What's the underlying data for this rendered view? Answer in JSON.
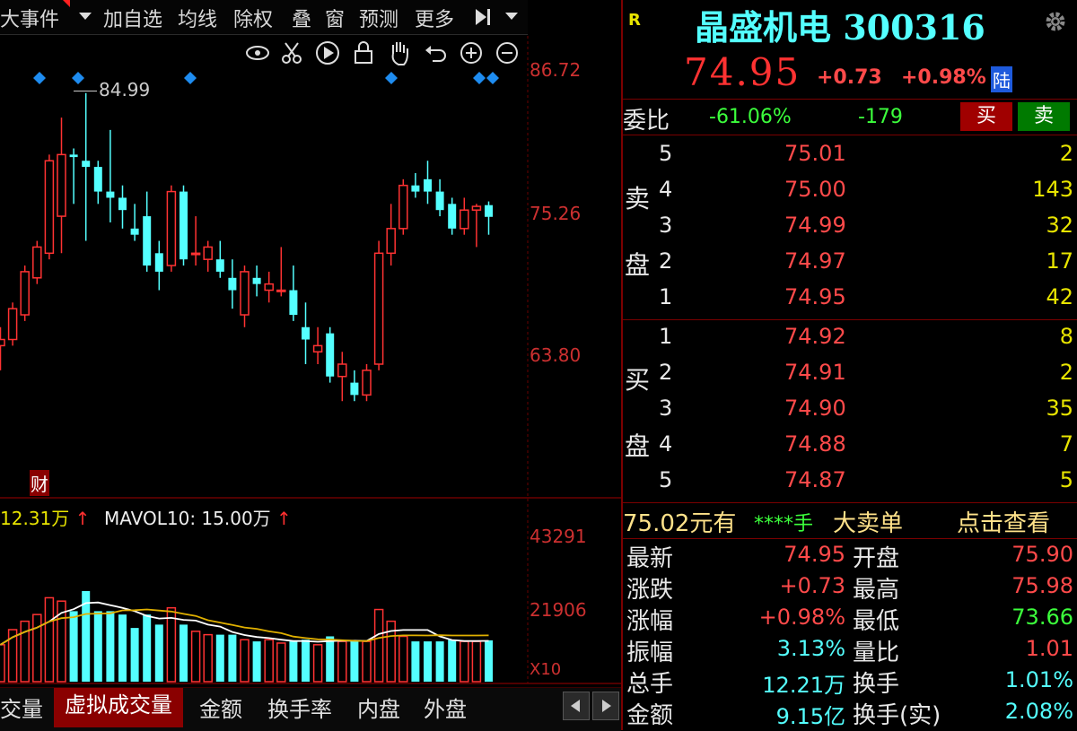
{
  "toolbar": {
    "items": [
      "大事件",
      "加自选",
      "均线",
      "除权",
      "叠",
      "窗",
      "预测",
      "更多"
    ]
  },
  "chart": {
    "high_label": "84.99",
    "price_axis": [
      "86.72",
      "75.26",
      "63.80"
    ],
    "fin_marker": "财",
    "vol_indicator": "12.31万",
    "mavol_label": "MAVOL10: 15.00万",
    "vol_axis": [
      "43291",
      "21906",
      "X10"
    ]
  },
  "chart_data": {
    "type": "candlestick",
    "candles": [
      {
        "o": 64.5,
        "h": 66.0,
        "l": 62.5,
        "c": 65.0
      },
      {
        "o": 65.0,
        "h": 68.0,
        "l": 64.5,
        "c": 67.5
      },
      {
        "o": 67.0,
        "h": 71.0,
        "l": 66.5,
        "c": 70.5
      },
      {
        "o": 70.0,
        "h": 73.0,
        "l": 69.5,
        "c": 72.5
      },
      {
        "o": 72.0,
        "h": 80.0,
        "l": 71.5,
        "c": 79.5
      },
      {
        "o": 75.0,
        "h": 83.0,
        "l": 72.0,
        "c": 80.0
      },
      {
        "o": 80.0,
        "h": 80.5,
        "l": 76.0,
        "c": 79.8
      },
      {
        "o": 79.5,
        "h": 84.99,
        "l": 73.0,
        "c": 79.0
      },
      {
        "o": 79.0,
        "h": 79.5,
        "l": 76.0,
        "c": 77.0
      },
      {
        "o": 77.0,
        "h": 82.0,
        "l": 74.5,
        "c": 76.5
      },
      {
        "o": 76.5,
        "h": 77.5,
        "l": 74.0,
        "c": 75.5
      },
      {
        "o": 74.0,
        "h": 76.0,
        "l": 73.0,
        "c": 73.5
      },
      {
        "o": 75.0,
        "h": 77.0,
        "l": 70.5,
        "c": 71.0
      },
      {
        "o": 72.0,
        "h": 73.0,
        "l": 69.0,
        "c": 70.5
      },
      {
        "o": 71.0,
        "h": 77.5,
        "l": 70.5,
        "c": 77.0
      },
      {
        "o": 77.0,
        "h": 77.5,
        "l": 71.0,
        "c": 71.5
      },
      {
        "o": 72.0,
        "h": 75.0,
        "l": 71.0,
        "c": 72.0
      },
      {
        "o": 71.5,
        "h": 73.0,
        "l": 70.5,
        "c": 72.5
      },
      {
        "o": 71.5,
        "h": 73.0,
        "l": 70.0,
        "c": 70.5
      },
      {
        "o": 70.0,
        "h": 71.5,
        "l": 67.5,
        "c": 69.0
      },
      {
        "o": 67.0,
        "h": 71.0,
        "l": 66.0,
        "c": 70.5
      },
      {
        "o": 70.0,
        "h": 71.0,
        "l": 68.5,
        "c": 69.5
      },
      {
        "o": 69.0,
        "h": 70.5,
        "l": 68.0,
        "c": 69.5
      },
      {
        "o": 69.0,
        "h": 72.5,
        "l": 68.5,
        "c": 69.0
      },
      {
        "o": 69.0,
        "h": 71.0,
        "l": 66.5,
        "c": 67.0
      },
      {
        "o": 66.0,
        "h": 68.0,
        "l": 63.0,
        "c": 65.0
      },
      {
        "o": 64.0,
        "h": 66.0,
        "l": 63.0,
        "c": 64.5
      },
      {
        "o": 65.5,
        "h": 66.0,
        "l": 61.5,
        "c": 62.0
      },
      {
        "o": 62.0,
        "h": 64.0,
        "l": 60.0,
        "c": 63.0
      },
      {
        "o": 61.5,
        "h": 62.5,
        "l": 60.0,
        "c": 60.5
      },
      {
        "o": 60.5,
        "h": 63.0,
        "l": 60.0,
        "c": 62.5
      },
      {
        "o": 63.0,
        "h": 73.0,
        "l": 62.5,
        "c": 72.0
      },
      {
        "o": 72.0,
        "h": 76.0,
        "l": 71.0,
        "c": 74.0
      },
      {
        "o": 74.0,
        "h": 78.0,
        "l": 73.5,
        "c": 77.5
      },
      {
        "o": 77.5,
        "h": 78.5,
        "l": 76.5,
        "c": 77.0
      },
      {
        "o": 78.0,
        "h": 79.5,
        "l": 76.0,
        "c": 77.0
      },
      {
        "o": 77.0,
        "h": 78.0,
        "l": 75.0,
        "c": 75.5
      },
      {
        "o": 76.0,
        "h": 76.5,
        "l": 73.5,
        "c": 74.0
      },
      {
        "o": 74.0,
        "h": 76.5,
        "l": 73.5,
        "c": 75.5
      },
      {
        "o": 75.5,
        "h": 76.0,
        "l": 72.5,
        "c": 75.8
      },
      {
        "o": 75.9,
        "h": 76.2,
        "l": 73.5,
        "c": 74.95
      }
    ],
    "volumes": [
      11000,
      15500,
      18000,
      20000,
      25000,
      24000,
      21000,
      27000,
      21000,
      21000,
      20000,
      16000,
      20000,
      17000,
      22000,
      17000,
      15000,
      14000,
      14000,
      14000,
      12500,
      12000,
      12500,
      11500,
      12000,
      12500,
      11000,
      13500,
      12000,
      12000,
      12000,
      21500,
      18000,
      13500,
      12000,
      12000,
      12000,
      12500,
      12000,
      12000,
      12310
    ],
    "up_color": "#ff3232",
    "down_color": "#54ffff"
  },
  "quote": {
    "r_tag": "R",
    "name": "晶盛机电 300316",
    "price": "74.95",
    "change": "+0.73",
    "change_pct": "+0.98%",
    "tag": "陆",
    "weibi_label": "委比",
    "weibi_pct": "-61.06%",
    "weicha": "-179",
    "buy_btn": "买",
    "sell_btn": "卖"
  },
  "orderbook": {
    "sell_label_1": "卖",
    "sell_label_2": "盘",
    "buy_label_1": "买",
    "buy_label_2": "盘",
    "asks": [
      {
        "lvl": "5",
        "price": "75.01",
        "vol": "2"
      },
      {
        "lvl": "4",
        "price": "75.00",
        "vol": "143"
      },
      {
        "lvl": "3",
        "price": "74.99",
        "vol": "32"
      },
      {
        "lvl": "2",
        "price": "74.97",
        "vol": "17"
      },
      {
        "lvl": "1",
        "price": "74.95",
        "vol": "42"
      }
    ],
    "bids": [
      {
        "lvl": "1",
        "price": "74.92",
        "vol": "8"
      },
      {
        "lvl": "2",
        "price": "74.91",
        "vol": "2"
      },
      {
        "lvl": "3",
        "price": "74.90",
        "vol": "35"
      },
      {
        "lvl": "4",
        "price": "74.88",
        "vol": "7"
      },
      {
        "lvl": "5",
        "price": "74.87",
        "vol": "5"
      }
    ]
  },
  "bigorder": {
    "price": "75.02元有",
    "stars": "****手",
    "label": "大卖单",
    "link": "点击查看"
  },
  "stats": {
    "left": [
      {
        "label": "最新",
        "value": "74.95",
        "color": "#ff4a4a"
      },
      {
        "label": "涨跌",
        "value": "+0.73",
        "color": "#ff4a4a"
      },
      {
        "label": "涨幅",
        "value": "+0.98%",
        "color": "#ff4a4a"
      },
      {
        "label": "振幅",
        "value": "3.13%",
        "color": "#54ffff"
      },
      {
        "label": "总手",
        "value": "12.21万",
        "color": "#54ffff"
      },
      {
        "label": "金额",
        "value": "9.15亿",
        "color": "#54ffff"
      }
    ],
    "right": [
      {
        "label": "开盘",
        "value": "75.90",
        "color": "#ff4a4a"
      },
      {
        "label": "最高",
        "value": "75.98",
        "color": "#ff4a4a"
      },
      {
        "label": "最低",
        "value": "73.66",
        "color": "#3cff3c"
      },
      {
        "label": "量比",
        "value": "1.01",
        "color": "#ff4a4a"
      },
      {
        "label": "换手",
        "value": "1.01%",
        "color": "#54ffff"
      },
      {
        "label": "换手(实)",
        "value": "2.08%",
        "color": "#54ffff"
      }
    ]
  },
  "bottom_tabs": [
    "交量",
    "虚拟成交量",
    "金额",
    "换手率",
    "内盘",
    "外盘"
  ]
}
